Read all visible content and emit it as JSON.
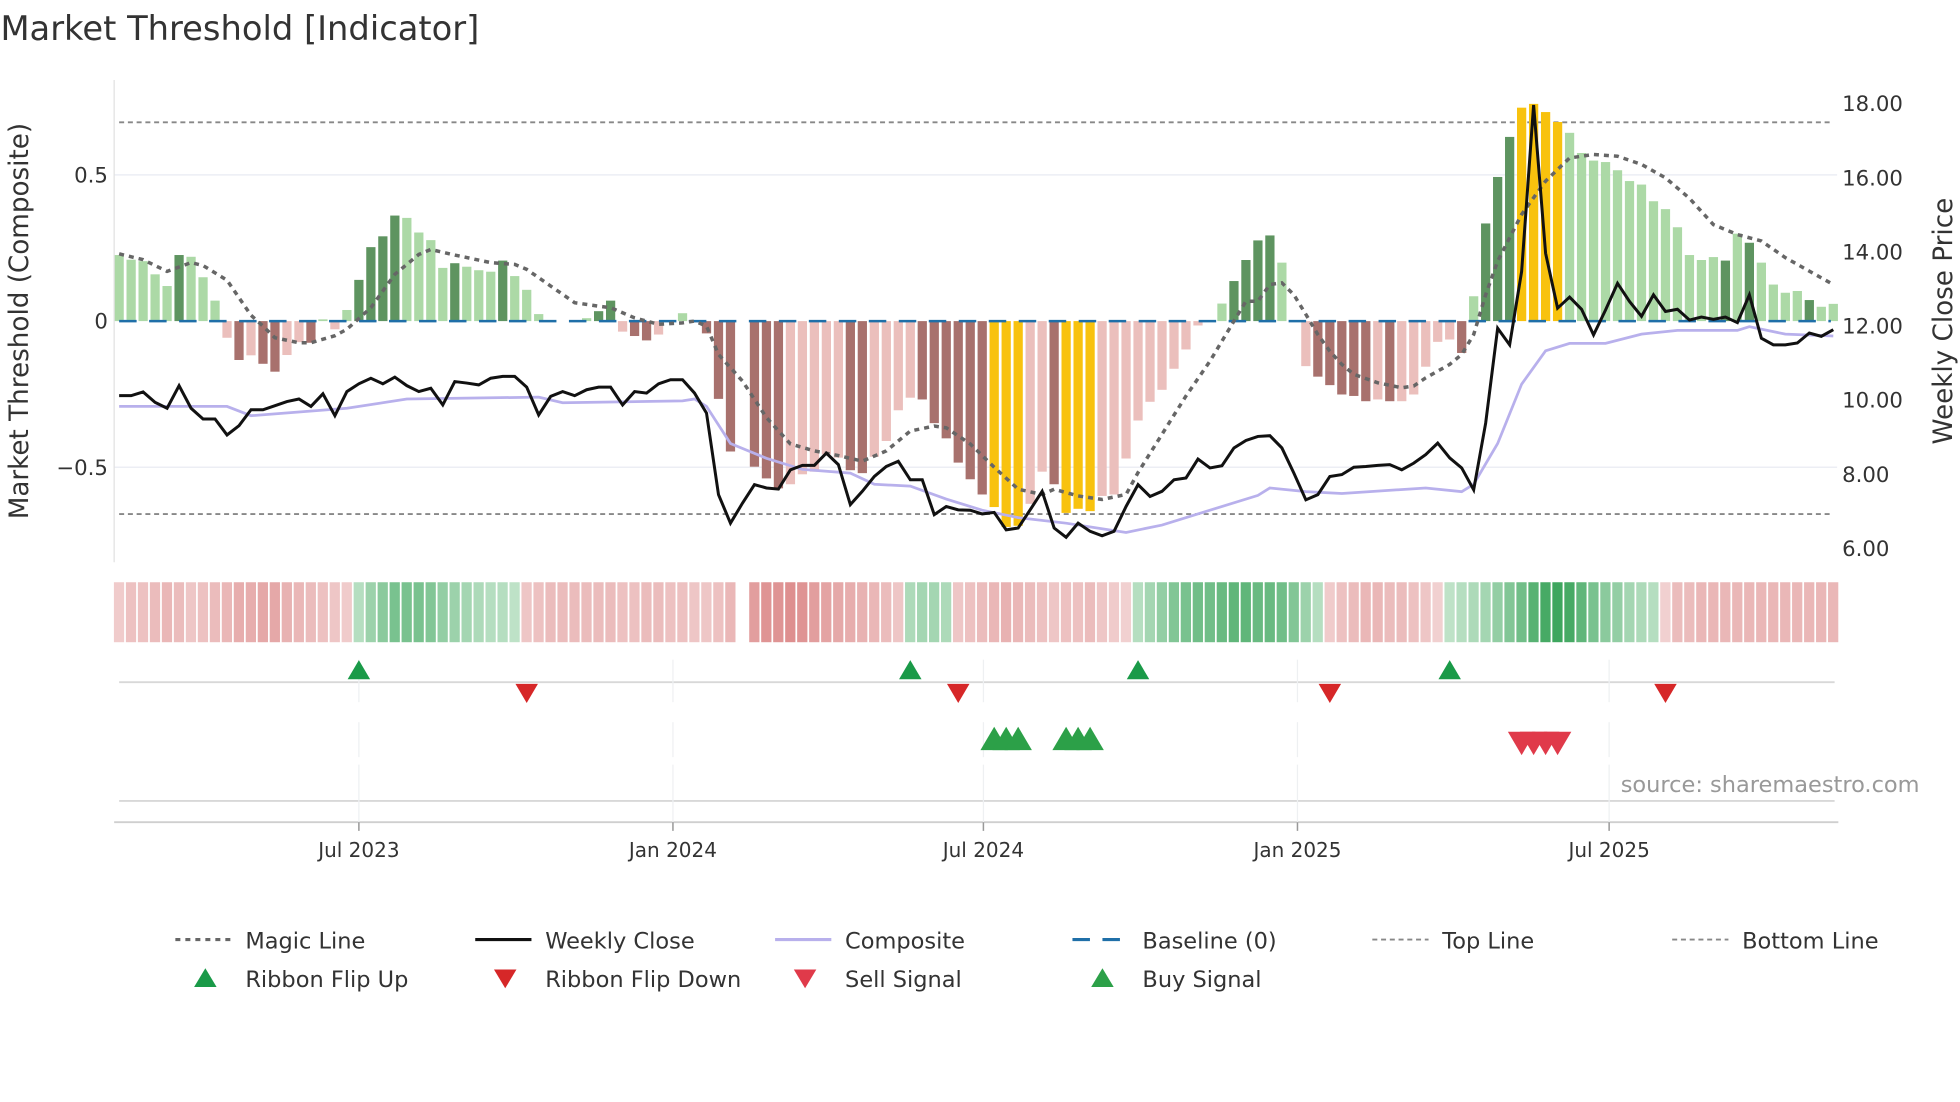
{
  "title": "Market Threshold [Indicator]",
  "source": "source: sharemaestro.com",
  "chart_data": {
    "type": "bar",
    "title": "Market Threshold [Indicator]",
    "ylabel": "Market Threshold (Composite)",
    "ylabel_right": "Weekly Close Price",
    "ylim": [
      -0.82,
      0.82
    ],
    "ylim_right": [
      6.0,
      18.0
    ],
    "yticks": [
      {
        "v": 0.5,
        "label": "0.5"
      },
      {
        "v": 0,
        "label": "0"
      },
      {
        "v": -0.5,
        "label": "−0.5"
      }
    ],
    "yticks_right": [
      {
        "v": 18,
        "label": "18.00"
      },
      {
        "v": 16,
        "label": "16.00"
      },
      {
        "v": 14,
        "label": "14.00"
      },
      {
        "v": 12,
        "label": "12.00"
      },
      {
        "v": 10,
        "label": "10.00"
      },
      {
        "v": 8,
        "label": "8.00"
      },
      {
        "v": 6,
        "label": "6.00"
      }
    ],
    "xticks": [
      {
        "week": 21,
        "label": "Jul 2023"
      },
      {
        "week": 47.2,
        "label": "Jan 2024"
      },
      {
        "week": 73.1,
        "label": "Jul 2024"
      },
      {
        "week": 99.3,
        "label": "Jan 2025"
      },
      {
        "week": 125.3,
        "label": "Jul 2025"
      }
    ],
    "top_line": 0.68,
    "bottom_line": -0.66,
    "baseline": 0,
    "composite_bars": [
      0.226,
      0.21,
      0.205,
      0.16,
      0.12,
      0.226,
      0.22,
      0.15,
      0.07,
      -0.057,
      -0.133,
      -0.117,
      -0.146,
      -0.173,
      -0.116,
      -0.072,
      -0.074,
      0.006,
      -0.028,
      0.038,
      0.141,
      0.253,
      0.29,
      0.361,
      0.353,
      0.303,
      0.277,
      0.182,
      0.198,
      0.186,
      0.174,
      0.169,
      0.207,
      0.154,
      0.107,
      0.024,
      0,
      0,
      -0.002,
      0.01,
      0.034,
      0.07,
      -0.036,
      -0.051,
      -0.066,
      -0.046,
      0,
      0.027,
      -0.005,
      -0.042,
      -0.266,
      -0.446,
      0,
      -0.498,
      -0.538,
      -0.572,
      -0.558,
      -0.524,
      -0.515,
      -0.456,
      -0.467,
      -0.51,
      -0.52,
      -0.464,
      -0.41,
      -0.305,
      -0.262,
      -0.268,
      -0.349,
      -0.401,
      -0.484,
      -0.541,
      -0.593,
      -0.636,
      -0.704,
      -0.7,
      -0.625,
      -0.515,
      -0.558,
      -0.656,
      -0.642,
      -0.65,
      -0.598,
      -0.593,
      -0.47,
      -0.34,
      -0.276,
      -0.235,
      -0.163,
      -0.097,
      -0.015,
      0,
      0.06,
      0.137,
      0.209,
      0.276,
      0.293,
      0.2,
      0,
      -0.154,
      -0.19,
      -0.219,
      -0.251,
      -0.256,
      -0.274,
      -0.268,
      -0.274,
      -0.274,
      -0.251,
      -0.156,
      -0.071,
      -0.063,
      -0.109,
      0.085,
      0.334,
      0.493,
      0.63,
      0.73,
      0.743,
      0.715,
      0.681,
      0.644,
      0.575,
      0.549,
      0.544,
      0.516,
      0.479,
      0.467,
      0.41,
      0.383,
      0.321,
      0.226,
      0.209,
      0.219,
      0.207,
      0.299,
      0.268,
      0.2,
      0.125,
      0.097,
      0.103,
      0.072,
      0.049,
      0.059
    ],
    "bar_states": "gggggGgggrRrRRrrRgrgGGGGggggGgggGggg--rgGGrRRr-grRRR-RRRrrrrrRRrrrrRRRRRRyyyrrRyyyrrrrrrrrr-gGGGGg-rRRRRRrRrrrrrRgGGGyyyygggggggggggggGgGggggGggG",
    "bar_state_key": {
      "g": "rising positive",
      "G": "strong positive",
      "r": "weak negative",
      "R": "strong negative",
      "y": "extreme"
    },
    "weekly_close": [
      10.09,
      10.09,
      10.19,
      9.91,
      9.75,
      10.36,
      9.75,
      9.46,
      9.46,
      9.03,
      9.28,
      9.71,
      9.71,
      9.82,
      9.93,
      10.0,
      9.8,
      10.14,
      9.55,
      10.2,
      10.41,
      10.56,
      10.41,
      10.59,
      10.36,
      10.2,
      10.29,
      9.84,
      10.47,
      10.43,
      10.38,
      10.56,
      10.61,
      10.61,
      10.32,
      9.57,
      10.07,
      10.2,
      10.09,
      10.25,
      10.32,
      10.32,
      9.84,
      10.2,
      10.16,
      10.41,
      10.52,
      10.52,
      10.16,
      9.62,
      7.42,
      6.65,
      7.19,
      7.69,
      7.6,
      7.57,
      8.09,
      8.21,
      8.21,
      8.54,
      8.23,
      7.15,
      7.51,
      7.91,
      8.18,
      8.32,
      7.82,
      7.82,
      6.88,
      7.1,
      7.01,
      7.0,
      6.9,
      6.94,
      6.47,
      6.52,
      7.01,
      7.51,
      6.52,
      6.27,
      6.65,
      6.43,
      6.31,
      6.43,
      7.1,
      7.69,
      7.37,
      7.51,
      7.82,
      7.87,
      8.38,
      8.14,
      8.2,
      8.68,
      8.88,
      8.99,
      9.01,
      8.68,
      8.0,
      7.28,
      7.42,
      7.91,
      7.96,
      8.16,
      8.18,
      8.21,
      8.23,
      8.09,
      8.27,
      8.5,
      8.81,
      8.41,
      8.14,
      7.55,
      9.35,
      11.91,
      11.46,
      13.44,
      17.93,
      13.93,
      12.45,
      12.75,
      12.42,
      11.73,
      12.4,
      13.12,
      12.63,
      12.23,
      12.81,
      12.36,
      12.42,
      12.13,
      12.21,
      12.15,
      12.21,
      12.06,
      12.81,
      11.64,
      11.46,
      11.46,
      11.51,
      11.78,
      11.69,
      11.87
    ],
    "composite_line": [
      [
        1,
        9.8
      ],
      [
        10,
        9.8
      ],
      [
        12,
        9.55
      ],
      [
        20,
        9.75
      ],
      [
        25,
        10.0
      ],
      [
        36,
        10.05
      ],
      [
        38,
        9.9
      ],
      [
        48,
        9.95
      ],
      [
        49,
        10.0
      ],
      [
        50,
        9.8
      ],
      [
        52,
        8.8
      ],
      [
        55,
        8.4
      ],
      [
        58,
        8.1
      ],
      [
        62,
        8.0
      ],
      [
        64,
        7.7
      ],
      [
        67,
        7.65
      ],
      [
        70,
        7.3
      ],
      [
        73,
        7.0
      ],
      [
        76,
        6.8
      ],
      [
        80,
        6.65
      ],
      [
        84,
        6.45
      ],
      [
        85,
        6.4
      ],
      [
        88,
        6.6
      ],
      [
        92,
        7.0
      ],
      [
        96,
        7.4
      ],
      [
        97,
        7.6
      ],
      [
        100,
        7.5
      ],
      [
        103,
        7.45
      ],
      [
        110,
        7.6
      ],
      [
        113,
        7.5
      ],
      [
        114,
        7.7
      ],
      [
        116,
        8.8
      ],
      [
        118,
        10.4
      ],
      [
        120,
        11.3
      ],
      [
        122,
        11.5
      ],
      [
        125,
        11.5
      ],
      [
        128,
        11.75
      ],
      [
        131,
        11.85
      ],
      [
        136,
        11.85
      ],
      [
        137,
        11.95
      ],
      [
        140,
        11.75
      ],
      [
        144,
        11.7
      ]
    ],
    "magic_line": [
      [
        1,
        0.23
      ],
      [
        3,
        0.21
      ],
      [
        5,
        0.17
      ],
      [
        7,
        0.2
      ],
      [
        8,
        0.19
      ],
      [
        9,
        0.165
      ],
      [
        10,
        0.14
      ],
      [
        11,
        0.08
      ],
      [
        12,
        0.02
      ],
      [
        13,
        -0.017
      ],
      [
        14,
        -0.057
      ],
      [
        16,
        -0.074
      ],
      [
        17,
        -0.074
      ],
      [
        19,
        -0.05
      ],
      [
        20,
        -0.028
      ],
      [
        22,
        0.046
      ],
      [
        24,
        0.16
      ],
      [
        26,
        0.228
      ],
      [
        27,
        0.245
      ],
      [
        29,
        0.226
      ],
      [
        32,
        0.2
      ],
      [
        34,
        0.194
      ],
      [
        35,
        0.177
      ],
      [
        37,
        0.12
      ],
      [
        39,
        0.063
      ],
      [
        41,
        0.051
      ],
      [
        42,
        0.046
      ],
      [
        44,
        0.011
      ],
      [
        46,
        -0.011
      ],
      [
        48,
        -0.006
      ],
      [
        49,
        0
      ],
      [
        50,
        -0.017
      ],
      [
        51,
        -0.114
      ],
      [
        53,
        -0.205
      ],
      [
        55,
        -0.33
      ],
      [
        57,
        -0.42
      ],
      [
        59,
        -0.444
      ],
      [
        61,
        -0.46
      ],
      [
        63,
        -0.479
      ],
      [
        65,
        -0.444
      ],
      [
        67,
        -0.376
      ],
      [
        69,
        -0.359
      ],
      [
        70,
        -0.365
      ],
      [
        72,
        -0.42
      ],
      [
        74,
        -0.5
      ],
      [
        76,
        -0.575
      ],
      [
        78,
        -0.593
      ],
      [
        79,
        -0.575
      ],
      [
        81,
        -0.598
      ],
      [
        83,
        -0.61
      ],
      [
        85,
        -0.593
      ],
      [
        86,
        -0.518
      ],
      [
        88,
        -0.387
      ],
      [
        90,
        -0.256
      ],
      [
        92,
        -0.137
      ],
      [
        94,
        0
      ],
      [
        95,
        0.068
      ],
      [
        96,
        0.068
      ],
      [
        97,
        0.125
      ],
      [
        98,
        0.131
      ],
      [
        99,
        0.09
      ],
      [
        100,
        0.023
      ],
      [
        101,
        -0.046
      ],
      [
        102,
        -0.103
      ],
      [
        103,
        -0.148
      ],
      [
        104,
        -0.182
      ],
      [
        106,
        -0.211
      ],
      [
        108,
        -0.228
      ],
      [
        109,
        -0.222
      ],
      [
        110,
        -0.194
      ],
      [
        112,
        -0.148
      ],
      [
        113,
        -0.114
      ],
      [
        114,
        -0.046
      ],
      [
        115,
        0.09
      ],
      [
        116,
        0.205
      ],
      [
        118,
        0.365
      ],
      [
        120,
        0.479
      ],
      [
        122,
        0.558
      ],
      [
        124,
        0.57
      ],
      [
        126,
        0.564
      ],
      [
        128,
        0.536
      ],
      [
        130,
        0.49
      ],
      [
        132,
        0.42
      ],
      [
        134,
        0.33
      ],
      [
        136,
        0.296
      ],
      [
        138,
        0.274
      ],
      [
        140,
        0.217
      ],
      [
        142,
        0.171
      ],
      [
        144,
        0.125
      ]
    ],
    "ribbon": [
      -0.15,
      -0.25,
      -0.25,
      -0.3,
      -0.35,
      -0.3,
      -0.2,
      -0.25,
      -0.3,
      -0.35,
      -0.45,
      -0.45,
      -0.5,
      -0.5,
      -0.4,
      -0.35,
      -0.3,
      -0.25,
      -0.2,
      -0.15,
      0.2,
      0.35,
      0.45,
      0.55,
      0.55,
      0.55,
      0.5,
      0.4,
      0.35,
      0.3,
      0.25,
      0.2,
      0.2,
      0.15,
      -0.2,
      -0.25,
      -0.3,
      -0.3,
      -0.3,
      -0.3,
      -0.3,
      -0.3,
      -0.25,
      -0.25,
      -0.3,
      -0.3,
      -0.25,
      -0.25,
      -0.2,
      -0.2,
      -0.25,
      -0.35,
      null,
      -0.6,
      -0.7,
      -0.7,
      -0.75,
      -0.7,
      -0.6,
      -0.55,
      -0.5,
      -0.45,
      -0.4,
      -0.35,
      -0.3,
      -0.2,
      0.25,
      0.3,
      0.3,
      0.25,
      -0.2,
      -0.25,
      -0.3,
      -0.35,
      -0.4,
      -0.35,
      -0.3,
      -0.25,
      -0.2,
      -0.25,
      -0.25,
      -0.3,
      -0.2,
      -0.15,
      -0.1,
      0.2,
      0.3,
      0.4,
      0.5,
      0.55,
      0.6,
      0.6,
      0.65,
      0.7,
      0.7,
      0.65,
      0.65,
      0.6,
      0.5,
      0.35,
      0.2,
      -0.15,
      -0.25,
      -0.3,
      -0.35,
      -0.35,
      -0.3,
      -0.3,
      -0.25,
      -0.2,
      -0.1,
      0.15,
      0.2,
      0.25,
      0.3,
      0.4,
      0.5,
      0.6,
      0.75,
      0.85,
      0.9,
      0.85,
      0.7,
      0.55,
      0.45,
      0.4,
      0.3,
      0.25,
      0.2,
      -0.1,
      -0.3,
      -0.3,
      -0.35,
      -0.35,
      -0.35,
      -0.35,
      -0.35,
      -0.35,
      -0.35,
      -0.35,
      -0.35,
      -0.35,
      -0.35,
      -0.35
    ],
    "ribbon_flip_up_weeks": [
      21,
      67,
      86,
      112
    ],
    "ribbon_flip_down_weeks": [
      35,
      71,
      102,
      130
    ],
    "buy_signal_weeks": [
      74,
      75,
      76,
      80,
      81,
      82
    ],
    "sell_signal_weeks": [
      118,
      119,
      120,
      121
    ],
    "legend": [
      {
        "label": "Magic Line",
        "kind": "dotted",
        "color": "#666666"
      },
      {
        "label": "Weekly Close",
        "kind": "line",
        "color": "#111111"
      },
      {
        "label": "Composite",
        "kind": "line",
        "color": "#b8b0ec"
      },
      {
        "label": "Baseline (0)",
        "kind": "dashed",
        "color": "#1f6fa8"
      },
      {
        "label": "Top Line",
        "kind": "finedash",
        "color": "#888888"
      },
      {
        "label": "Bottom Line",
        "kind": "finedash",
        "color": "#888888"
      },
      {
        "label": "Ribbon Flip Up",
        "kind": "up",
        "color": "#1a9a48"
      },
      {
        "label": "Ribbon Flip Down",
        "kind": "down",
        "color": "#d62728"
      },
      {
        "label": "Sell Signal",
        "kind": "down",
        "color": "#e03a4a"
      },
      {
        "label": "Buy Signal",
        "kind": "up",
        "color": "#2ca048"
      }
    ],
    "colors": {
      "g": "#acd9a6",
      "G": "#5e9460",
      "r": "#ebbfbc",
      "R": "#a8716d",
      "y": "#f8c20e",
      "baseline": "#1f6fa8",
      "composite": "#b8b0ec",
      "close": "#111111",
      "magic": "#666666",
      "refline": "#888888"
    }
  }
}
